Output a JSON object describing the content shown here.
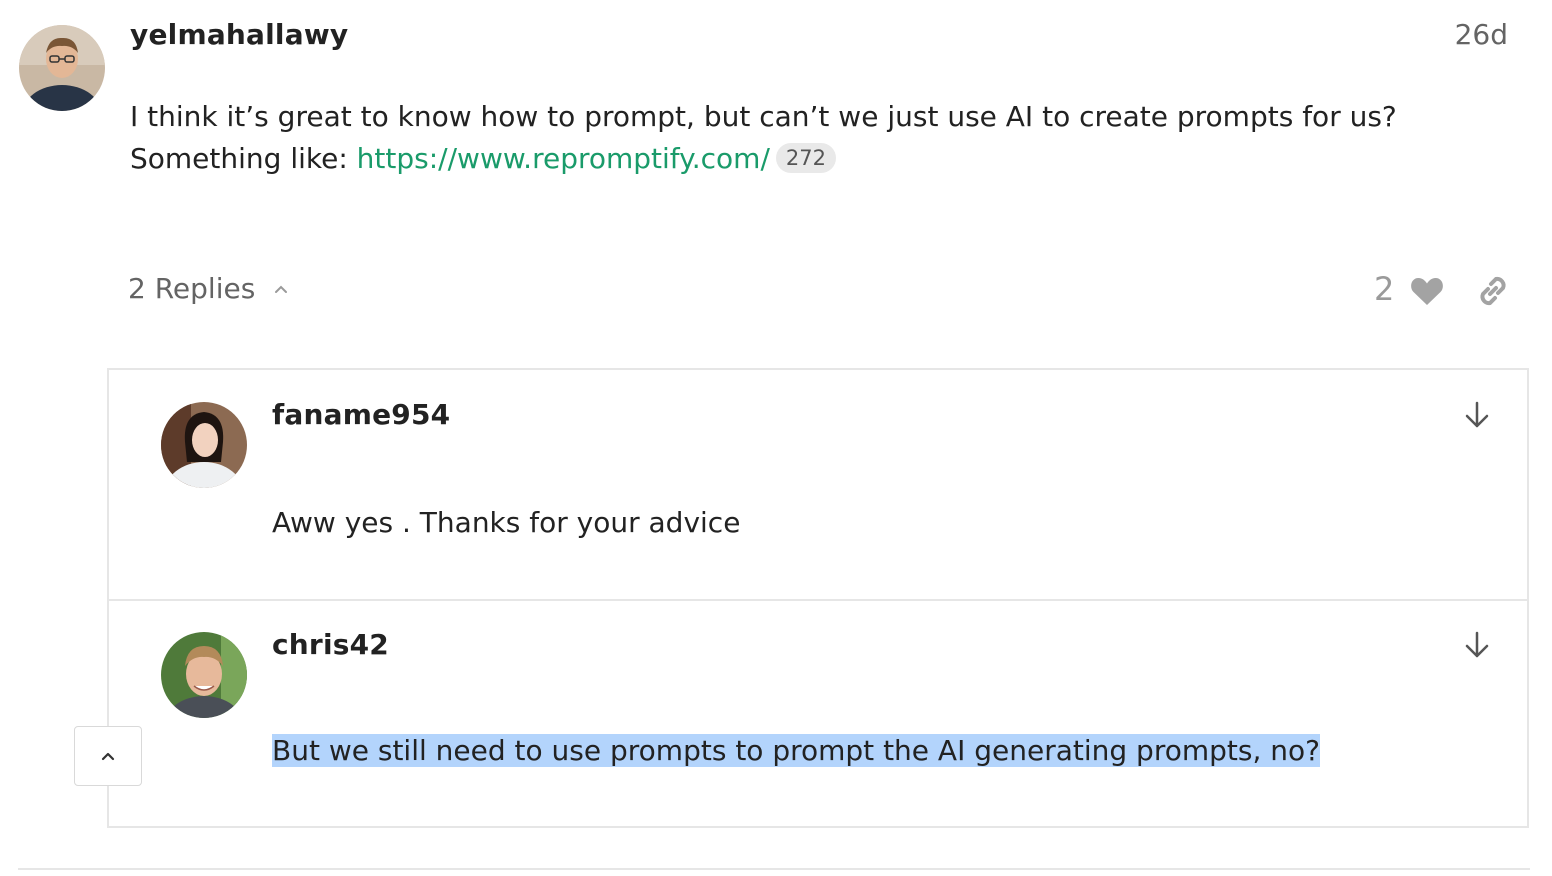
{
  "post": {
    "username": "yelmahallawy",
    "date": "26d",
    "body_line1": "I think it’s great to know how to prompt, but can’t we just use AI to create prompts for us?",
    "body_line2_prefix": "Something like: ",
    "link_text": "https://www.repromptify.com/",
    "link_clicks": "272",
    "replies_label": "2 Replies",
    "like_count": "2"
  },
  "replies": [
    {
      "username": "faname954",
      "text": "Aww yes . Thanks for your advice"
    },
    {
      "username": "chris42",
      "text": "But we still need to use prompts to prompt the AI generating prompts, no?"
    }
  ],
  "icons": {
    "replies_toggle": "chevron-up-icon",
    "like": "heart-icon",
    "share": "link-icon",
    "jump_to_reply": "arrow-down-icon",
    "scroll_top": "chevron-up-icon"
  },
  "colors": {
    "link": "#1a9b6a",
    "selection_highlight": "#b3d4fc",
    "muted_text": "#646464",
    "border": "#e6e6e6"
  }
}
